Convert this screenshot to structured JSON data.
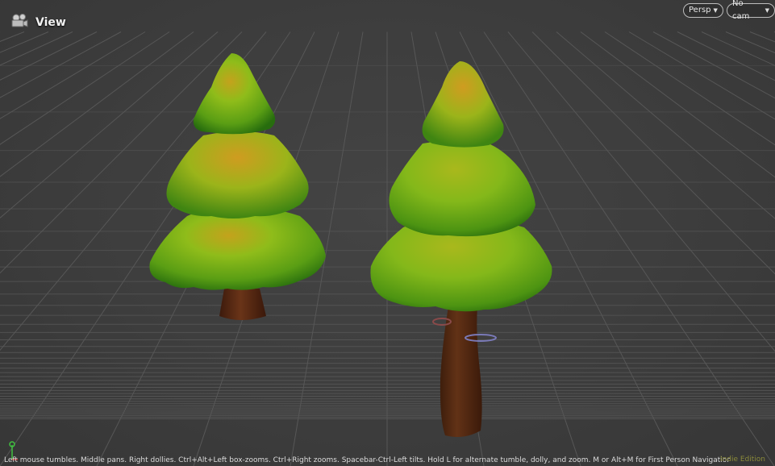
{
  "view": {
    "title": "View",
    "icon": "camera-reels-icon"
  },
  "toolbar": {
    "projection_label": "Persp",
    "camera_label": "No cam"
  },
  "status_bar": {
    "hint": "Left mouse tumbles. Middle pans. Right dollies. Ctrl+Alt+Left box-zooms. Ctrl+Right zooms. Spacebar-Ctrl-Left tilts. Hold L for alternate tumble, dolly, and zoom. M or Alt+M for First Person Navigation.",
    "edition": "Indie Edition"
  },
  "scene": {
    "objects": [
      {
        "name": "pine-tree-left"
      },
      {
        "name": "pine-tree-right"
      }
    ],
    "colors": {
      "background": "#3c3c3c",
      "grid": "#555555",
      "foliage_light": "#9ac21c",
      "foliage_dark": "#2f7a12",
      "foliage_tip": "#c8a020",
      "trunk": "#5a2a14",
      "gizmo_x": "#c84040",
      "gizmo_y": "#40c040"
    },
    "axis_gizmo_icon": "axis-gizmo-icon"
  }
}
